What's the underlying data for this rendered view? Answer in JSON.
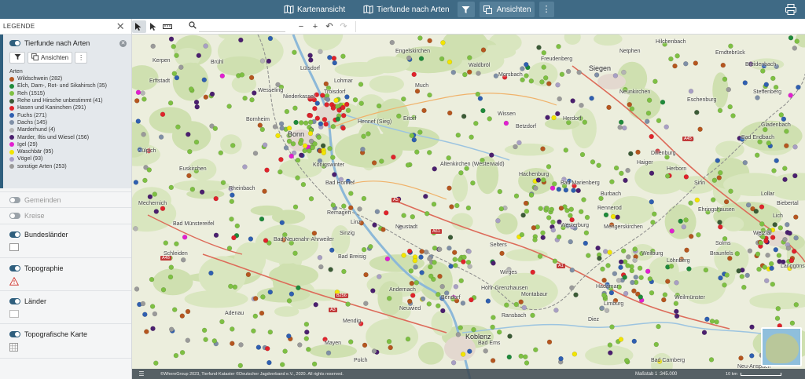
{
  "topbar": {
    "kartenansicht": "Kartenansicht",
    "tierfunde": "Tierfunde nach Arten",
    "ansichten": "Ansichten"
  },
  "sidebar": {
    "title": "LEGENDE",
    "active_layer": {
      "title": "Tierfunde nach Arten",
      "ansichten": "Ansichten",
      "arten_title": "Arten",
      "items": [
        {
          "label": "Wildschwein (282)",
          "color": "#b5561f"
        },
        {
          "label": "Elch, Dam-, Rot- und Sikahirsch (35)",
          "color": "#1f8a3a"
        },
        {
          "label": "Reh (1515)",
          "color": "#7ec043"
        },
        {
          "label": "Rehe und Hirsche unbestimmt (41)",
          "color": "#3b5b36"
        },
        {
          "label": "Hasen und Kaninchen (291)",
          "color": "#e0232b"
        },
        {
          "label": "Fuchs (271)",
          "color": "#2f5fb0"
        },
        {
          "label": "Dachs (145)",
          "color": "#7f8fa6"
        },
        {
          "label": "Marderhund (4)",
          "color": "#b4b4b4"
        },
        {
          "label": "Marder, Iltis und Wiesel (156)",
          "color": "#4b1f6f"
        },
        {
          "label": "Igel (29)",
          "color": "#e21fd0"
        },
        {
          "label": "Waschbär (95)",
          "color": "#f2e500"
        },
        {
          "label": "Vögel (93)",
          "color": "#a89fc4"
        },
        {
          "label": "sonstige Arten (253)",
          "color": "#9a9a9a"
        }
      ]
    },
    "layers": {
      "gemeinden": "Gemeinden",
      "kreise": "Kreise",
      "bundeslaender": "Bundesländer",
      "topographie": "Topographie",
      "laender": "Länder",
      "topo_karte": "Topografische Karte"
    }
  },
  "map": {
    "places": {
      "siegen": "Siegen",
      "bonn": "Bonn",
      "koblenz": "Koblenz",
      "euskirchen": "Euskirchen",
      "eitorf": "Eitorf",
      "lohmar": "Lohmar",
      "waldbroel": "Waldbröl",
      "hachenburg": "Hachenburg",
      "altenkirchen": "Altenkirchen (Westerwald)",
      "bad_marienberg": "Bad Marienberg",
      "montabaur": "Montabaur",
      "bad_ems": "Bad Ems",
      "mayen": "Mayen",
      "andernach": "Andernach",
      "bendorf": "Bendorf",
      "neuwied": "Neuwied",
      "bad_neuenahr": "Bad Neuenahr-Ahrweiler",
      "bad_muenstereifel": "Bad Münstereifel",
      "rheinbach": "Rheinbach",
      "zuelpich": "Zülpich",
      "mechernich": "Mechernich",
      "koenigswinter": "Königswinter",
      "bad_honnef": "Bad Honnef",
      "hennef": "Hennef (Sieg)",
      "herdorf": "Herdorf",
      "betzdorf": "Betzdorf",
      "wissen": "Wissen",
      "erndtebrueck": "Erndtebrück",
      "dillenburg": "Dillenburg",
      "herborn": "Herborn",
      "sinn": "Sinn",
      "wetzlar": "Wetzlar",
      "braunfels": "Braunfels",
      "weilburg": "Weilburg",
      "solms": "Solms",
      "hadamar": "Hadamar",
      "limburg": "Limburg",
      "diez": "Diez",
      "bad_camberg": "Bad Camberg",
      "lich": "Lich",
      "lollar": "Lollar",
      "biebertal": "Biebertal",
      "langgoens": "Langgöns",
      "sieg": "Siegburg",
      "troisdorf": "Troisdorf",
      "weilmuenster": "Weilmünster",
      "selters": "Selters",
      "ransbach": "Ransbach",
      "bad_breisig": "Bad Breisig",
      "sinzig": "Sinzig",
      "remagen": "Remagen",
      "linz": "Linz",
      "adenau": "Adenau",
      "mendig": "Mendig",
      "polch": "Polch",
      "hoehr": "Höhr-Grenzhausen",
      "neustadt": "Neustadt",
      "burbach": "Burbach",
      "haiger": "Haiger",
      "ehringshausen": "Ehringshausen",
      "loehnberg": "Löhnberg",
      "mengerskirchen": "Mengerskirchen",
      "rennerod": "Rennerod",
      "westerburg": "Westerburg",
      "wirges": "Wirges",
      "neunkirchen": "Neunkirchen",
      "eschenburg": "Eschenburg",
      "bad_endbach": "Bad Endbach",
      "gladenbach": "Gladenbach",
      "freudenberg": "Freudenberg",
      "netphen": "Netphen",
      "hilchenbach": "Hilchenbach",
      "breidenbach": "Breidenbach",
      "steffenberg": "Steffenberg",
      "morsbach": "Morsbach",
      "much": "Much",
      "engelskirchen": "Engelskirchen",
      "wesseling": "Wesseling",
      "bornheim": "Bornheim",
      "niederkassel": "Niederkassel",
      "luelsdorf": "Lülsdorf",
      "kerpen": "Kerpen",
      "erftstadt": "Erftstadt",
      "bruehl": "Brühl",
      "schleiden": "Schleiden",
      "neu_anspach": "Neu-Anspach"
    },
    "roads": [
      "A3",
      "A61",
      "A48",
      "A1",
      "B256",
      "A45",
      "A3"
    ],
    "status": {
      "copyright": "©WhereGroup 2023, Tierfund-Kataster ©Deutscher Jagdverband e.V., 2020. All rights reserved.",
      "scale": "Maßstab 1 :345.000",
      "scalebar": "10 km"
    }
  }
}
